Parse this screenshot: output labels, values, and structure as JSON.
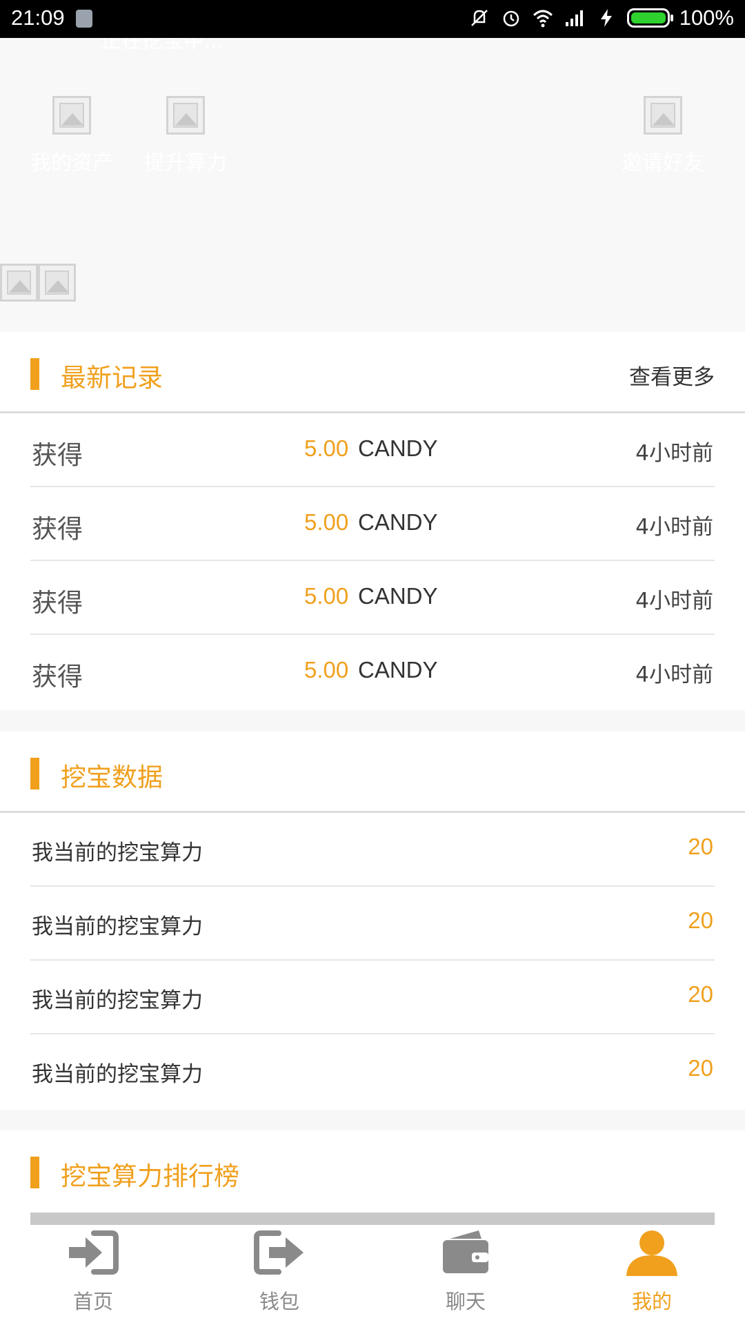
{
  "status_bar": {
    "time": "21:09",
    "battery": "100%"
  },
  "hero": {
    "mining_status": "正在挖宝中...",
    "buttons": [
      {
        "label": "我的资产",
        "icon": "image-placeholder-icon"
      },
      {
        "label": "提升算力",
        "icon": "image-placeholder-icon"
      },
      {
        "label": "邀请好友",
        "icon": "image-placeholder-icon"
      }
    ]
  },
  "records": {
    "title": "最新记录",
    "more": "查看更多",
    "rows": [
      {
        "label": "获得",
        "amount": "5.00",
        "unit": "CANDY",
        "time": "4小时前"
      },
      {
        "label": "获得",
        "amount": "5.00",
        "unit": "CANDY",
        "time": "4小时前"
      },
      {
        "label": "获得",
        "amount": "5.00",
        "unit": "CANDY",
        "time": "4小时前"
      },
      {
        "label": "获得",
        "amount": "5.00",
        "unit": "CANDY",
        "time": "4小时前"
      }
    ]
  },
  "mining": {
    "title": "挖宝数据",
    "rows": [
      {
        "label": "我当前的挖宝算力",
        "value": "20"
      },
      {
        "label": "我当前的挖宝算力",
        "value": "20"
      },
      {
        "label": "我当前的挖宝算力",
        "value": "20"
      },
      {
        "label": "我当前的挖宝算力",
        "value": "20"
      }
    ]
  },
  "ranking": {
    "title": "挖宝算力排行榜"
  },
  "tabbar": {
    "items": [
      {
        "label": "首页",
        "icon": "login-arrow-icon",
        "active": false
      },
      {
        "label": "钱包",
        "icon": "logout-arrow-icon",
        "active": false
      },
      {
        "label": "聊天",
        "icon": "wallet-icon",
        "active": false
      },
      {
        "label": "我的",
        "icon": "user-icon",
        "active": true
      }
    ]
  },
  "colors": {
    "accent": "#f0a01d",
    "inactive": "#8a8a8a"
  }
}
